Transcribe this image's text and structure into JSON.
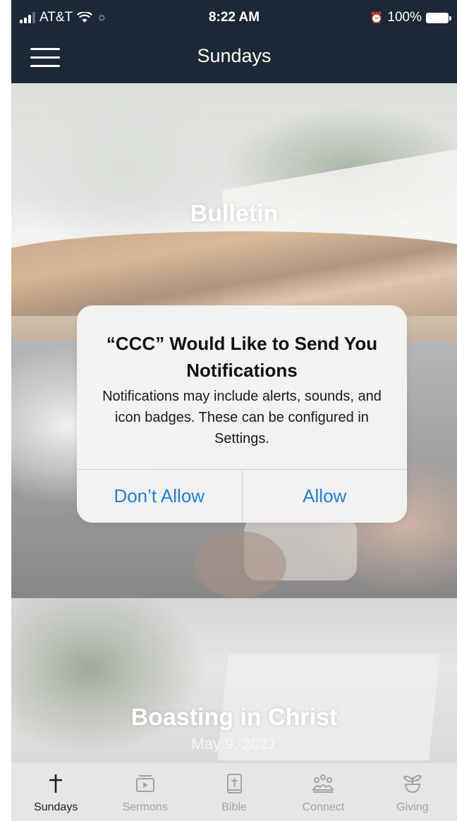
{
  "status_bar": {
    "carrier": "AT&T",
    "time": "8:22 AM",
    "battery": "100%"
  },
  "nav": {
    "title": "Sundays"
  },
  "cards": [
    {
      "title": "Bulletin"
    },
    {
      "title": ""
    },
    {
      "title": "Boasting in Christ",
      "date": "May 9, 2021"
    }
  ],
  "alert": {
    "title": "“CCC” Would Like to Send You Notifications",
    "message": "Notifications may include alerts, sounds, and icon badges. These can be configured in Settings.",
    "deny_label": "Don’t Allow",
    "allow_label": "Allow",
    "button_color": "#1f7fe0"
  },
  "tabs": [
    {
      "label": "Sundays",
      "icon": "cross-icon",
      "active": true
    },
    {
      "label": "Sermons",
      "icon": "video-icon",
      "active": false
    },
    {
      "label": "Bible",
      "icon": "bible-icon",
      "active": false
    },
    {
      "label": "Connect",
      "icon": "people-icon",
      "active": false
    },
    {
      "label": "Giving",
      "icon": "plant-icon",
      "active": false
    }
  ],
  "colors": {
    "nav_background": "#1b2836",
    "tab_active": "#1d1d1d",
    "tab_inactive": "#a3a3a3"
  }
}
